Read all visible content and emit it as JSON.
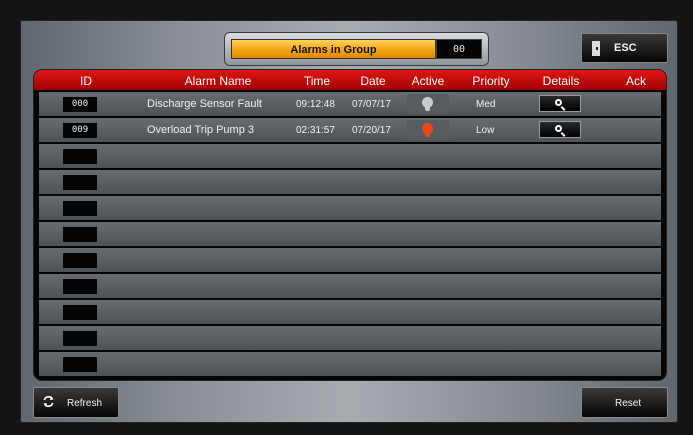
{
  "header": {
    "group_label": "Alarms in Group",
    "group_count": "00",
    "esc_label": "ESC"
  },
  "table": {
    "columns": [
      "ID",
      "Alarm Name",
      "Time",
      "Date",
      "Active",
      "Priority",
      "Details",
      "Ack"
    ],
    "rows": [
      {
        "id": "000",
        "name": "Discharge Sensor Fault",
        "time": "09:12:48",
        "date": "07/07/17",
        "active": false,
        "priority": "Med"
      },
      {
        "id": "009",
        "name": "Overload Trip Pump 3",
        "time": "02:31:57",
        "date": "07/20/17",
        "active": true,
        "priority": "Low"
      }
    ],
    "empty_rows": 9
  },
  "footer": {
    "refresh_label": "Refresh",
    "reset_label": "Reset"
  },
  "colors": {
    "header_red": "#c80000",
    "group_orange": "#f3a512",
    "active_bulb": "#f0451b",
    "inactive_bulb": "#c8ccd0"
  }
}
